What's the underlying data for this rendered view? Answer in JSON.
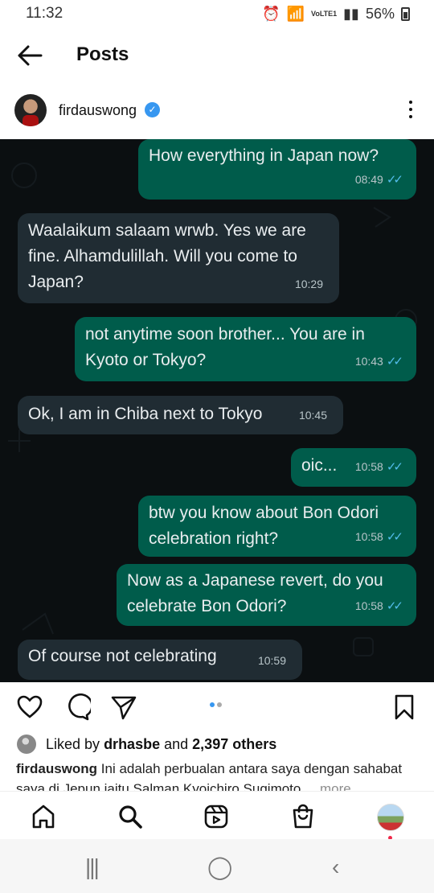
{
  "status_bar": {
    "time": "11:32",
    "network": "VoLTE1",
    "battery": "56%"
  },
  "header": {
    "title": "Posts"
  },
  "post": {
    "username": "firdauswong",
    "verified_icon": "verified-badge-icon",
    "messages": [
      {
        "direction": "outgoing",
        "text": "How everything in Japan now?",
        "time": "08:49",
        "read": true
      },
      {
        "direction": "incoming",
        "text": "Waalaikum salaam wrwb. Yes we are fine. Alhamdulillah. Will you come to Japan?",
        "lines": [
          "Waalaikum salaam wrwb. Yes we are",
          "fine. Alhamdulillah. Will you come to",
          "Japan?"
        ],
        "time": "10:29"
      },
      {
        "direction": "outgoing",
        "text": "not anytime soon brother... You are in Kyoto or Tokyo?",
        "lines": [
          "not anytime soon brother... You are in",
          "Kyoto or Tokyo?"
        ],
        "time": "10:43",
        "read": true
      },
      {
        "direction": "incoming",
        "text": "Ok, I am in Chiba next to Tokyo",
        "time": "10:45"
      },
      {
        "direction": "outgoing",
        "text": "oic...",
        "time": "10:58",
        "read": true
      },
      {
        "direction": "outgoing",
        "text": "btw you know about Bon Odori celebration right?",
        "lines": [
          "btw you know about Bon Odori",
          "celebration right?"
        ],
        "time": "10:58",
        "read": true
      },
      {
        "direction": "outgoing",
        "text": "Now as a Japanese revert, do you celebrate Bon Odori?",
        "lines": [
          "Now as a Japanese revert, do you",
          "celebrate Bon Odori?"
        ],
        "time": "10:58",
        "read": true
      },
      {
        "direction": "incoming",
        "text": "Of course not celebrating",
        "time": "10:59"
      }
    ],
    "likes": {
      "prefix": "Liked by",
      "user": "drhasbe",
      "middle": "and",
      "count": "2,397 others"
    },
    "caption": {
      "user": "firdauswong",
      "text": "Ini adalah perbualan antara saya dengan sahabat saya di Jepun iaitu Salman Kyoichiro Sugimoto....",
      "more": "more"
    },
    "carousel": {
      "current": 1,
      "total": 2
    }
  },
  "bottom_nav": [
    "home",
    "search",
    "reels",
    "shop",
    "profile"
  ],
  "system_nav": [
    "recent-apps",
    "home",
    "back"
  ]
}
